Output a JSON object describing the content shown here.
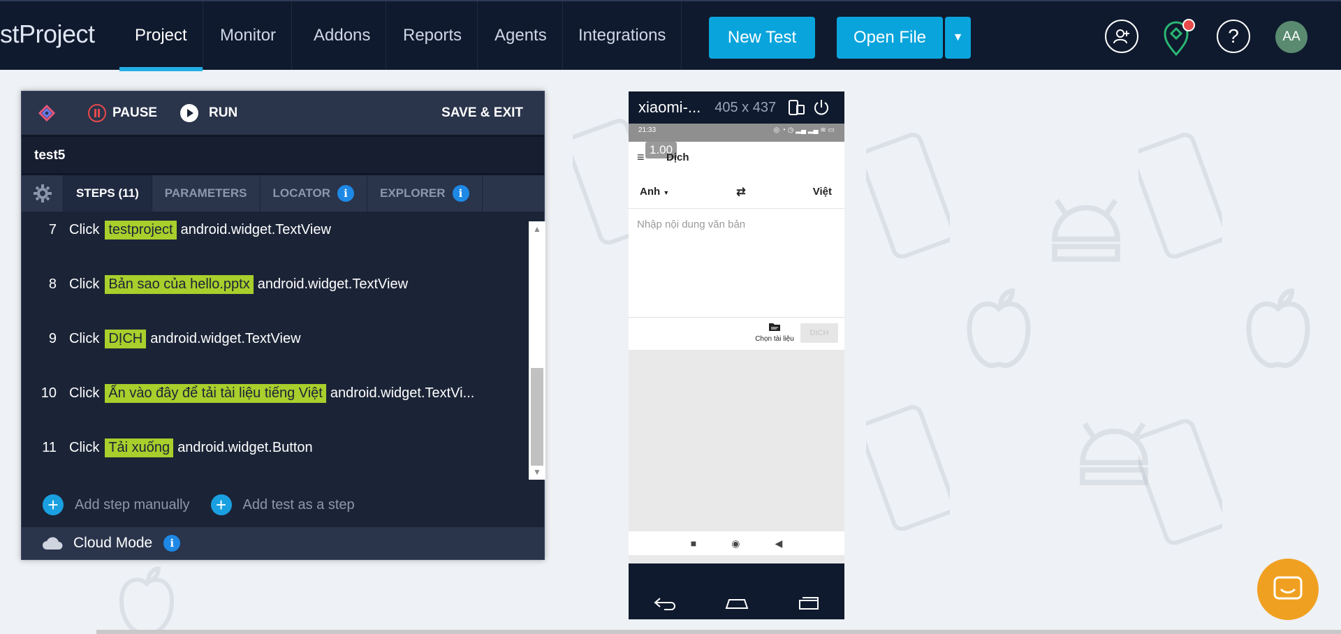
{
  "nav": {
    "brand": "stProject",
    "items": [
      {
        "label": "Project",
        "active": true
      },
      {
        "label": "Monitor",
        "active": false
      },
      {
        "label": "Addons",
        "active": false
      },
      {
        "label": "Reports",
        "active": false
      },
      {
        "label": "Agents",
        "active": false
      },
      {
        "label": "Integrations",
        "active": false
      }
    ],
    "new_test_label": "New Test",
    "open_file_label": "Open File",
    "avatar_initials": "AA"
  },
  "recorder": {
    "pause_label": "PAUSE",
    "run_label": "RUN",
    "save_exit_label": "SAVE & EXIT",
    "test_name": "test5",
    "tabs": {
      "steps": "STEPS (11)",
      "parameters": "PARAMETERS",
      "locator": "LOCATOR",
      "explorer": "EXPLORER"
    },
    "steps": [
      {
        "num": "7",
        "action": "Click",
        "target": "testproject",
        "element": "android.widget.TextView"
      },
      {
        "num": "8",
        "action": "Click",
        "target": "Bản sao của hello.pptx",
        "element": "android.widget.TextView"
      },
      {
        "num": "9",
        "action": "Click",
        "target": "DỊCH",
        "element": "android.widget.TextView"
      },
      {
        "num": "10",
        "action": "Click",
        "target": "Ấn vào đây để tải tài liệu tiếng Việt",
        "element": "android.widget.TextVi..."
      },
      {
        "num": "11",
        "action": "Click",
        "target": "Tải xuống",
        "element": "android.widget.Button"
      }
    ],
    "add_step_label": "Add step manually",
    "add_test_label": "Add test as a step",
    "cloud_mode_label": "Cloud Mode"
  },
  "device": {
    "name": "xiaomi-...",
    "resolution": "405 x 437",
    "status_time": "21:33",
    "zoom": "1.00",
    "app_title": "Dịch",
    "lang_from": "Anh",
    "lang_to": "Việt",
    "input_placeholder": "Nhập nội dung văn bản",
    "choose_doc_label": "Chọn tài liệu",
    "translate_label": "DỊCH"
  },
  "colors": {
    "nav_bg": "#0f1a2e",
    "accent": "#0aa4dc",
    "highlight": "#a8cf2c",
    "chat": "#f0a020"
  }
}
